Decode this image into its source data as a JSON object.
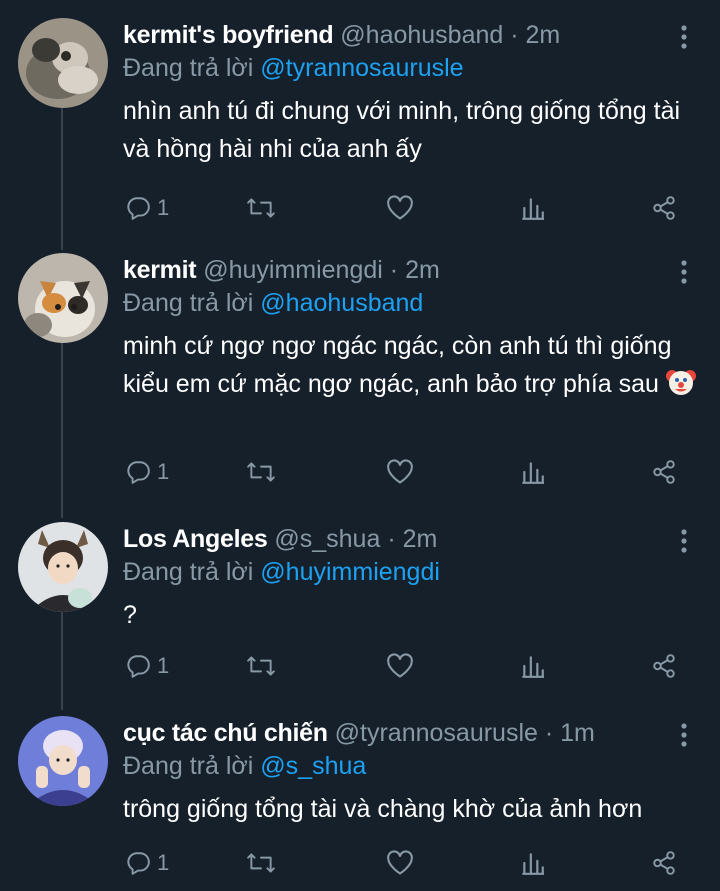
{
  "colors": {
    "background": "#15202b",
    "secondary_text": "#8899a6",
    "mention": "#1da1f2",
    "thread_line": "#38444d"
  },
  "reply_prefix": "Đang trả lời",
  "tweets": [
    {
      "display_name": "kermit's boyfriend",
      "handle": "@haohusband",
      "separator": "·",
      "time": "2m",
      "replying_to": "@tyrannosaurusle",
      "text": "nhìn anh tú đi chung với minh, trông giống tổng tài và hồng hài nhi của anh ấy",
      "reply_count": "1",
      "icons": [
        "reply-icon",
        "retweet-icon",
        "like-icon",
        "analytics-icon",
        "share-icon",
        "more-icon"
      ]
    },
    {
      "display_name": "kermit",
      "handle": "@huyimmiengdi",
      "separator": "·",
      "time": "2m",
      "replying_to": "@haohusband",
      "text": "minh cứ ngơ ngơ ngác ngác, còn anh tú thì giống kiểu em cứ mặc ngơ ngác, anh bảo trợ phía sau",
      "emoji": "clown-face",
      "reply_count": "1"
    },
    {
      "display_name": "Los Angeles",
      "handle": "@s_shua",
      "separator": "·",
      "time": "2m",
      "replying_to": "@huyimmiengdi",
      "text": "?",
      "reply_count": "1"
    },
    {
      "display_name": "cục tác chú chiến",
      "handle": "@tyrannosaurusle",
      "separator": "·",
      "time": "1m",
      "replying_to": "@s_shua",
      "text": "trông giống tổng tài và chàng khờ của ảnh hơn",
      "reply_count": "1"
    }
  ]
}
